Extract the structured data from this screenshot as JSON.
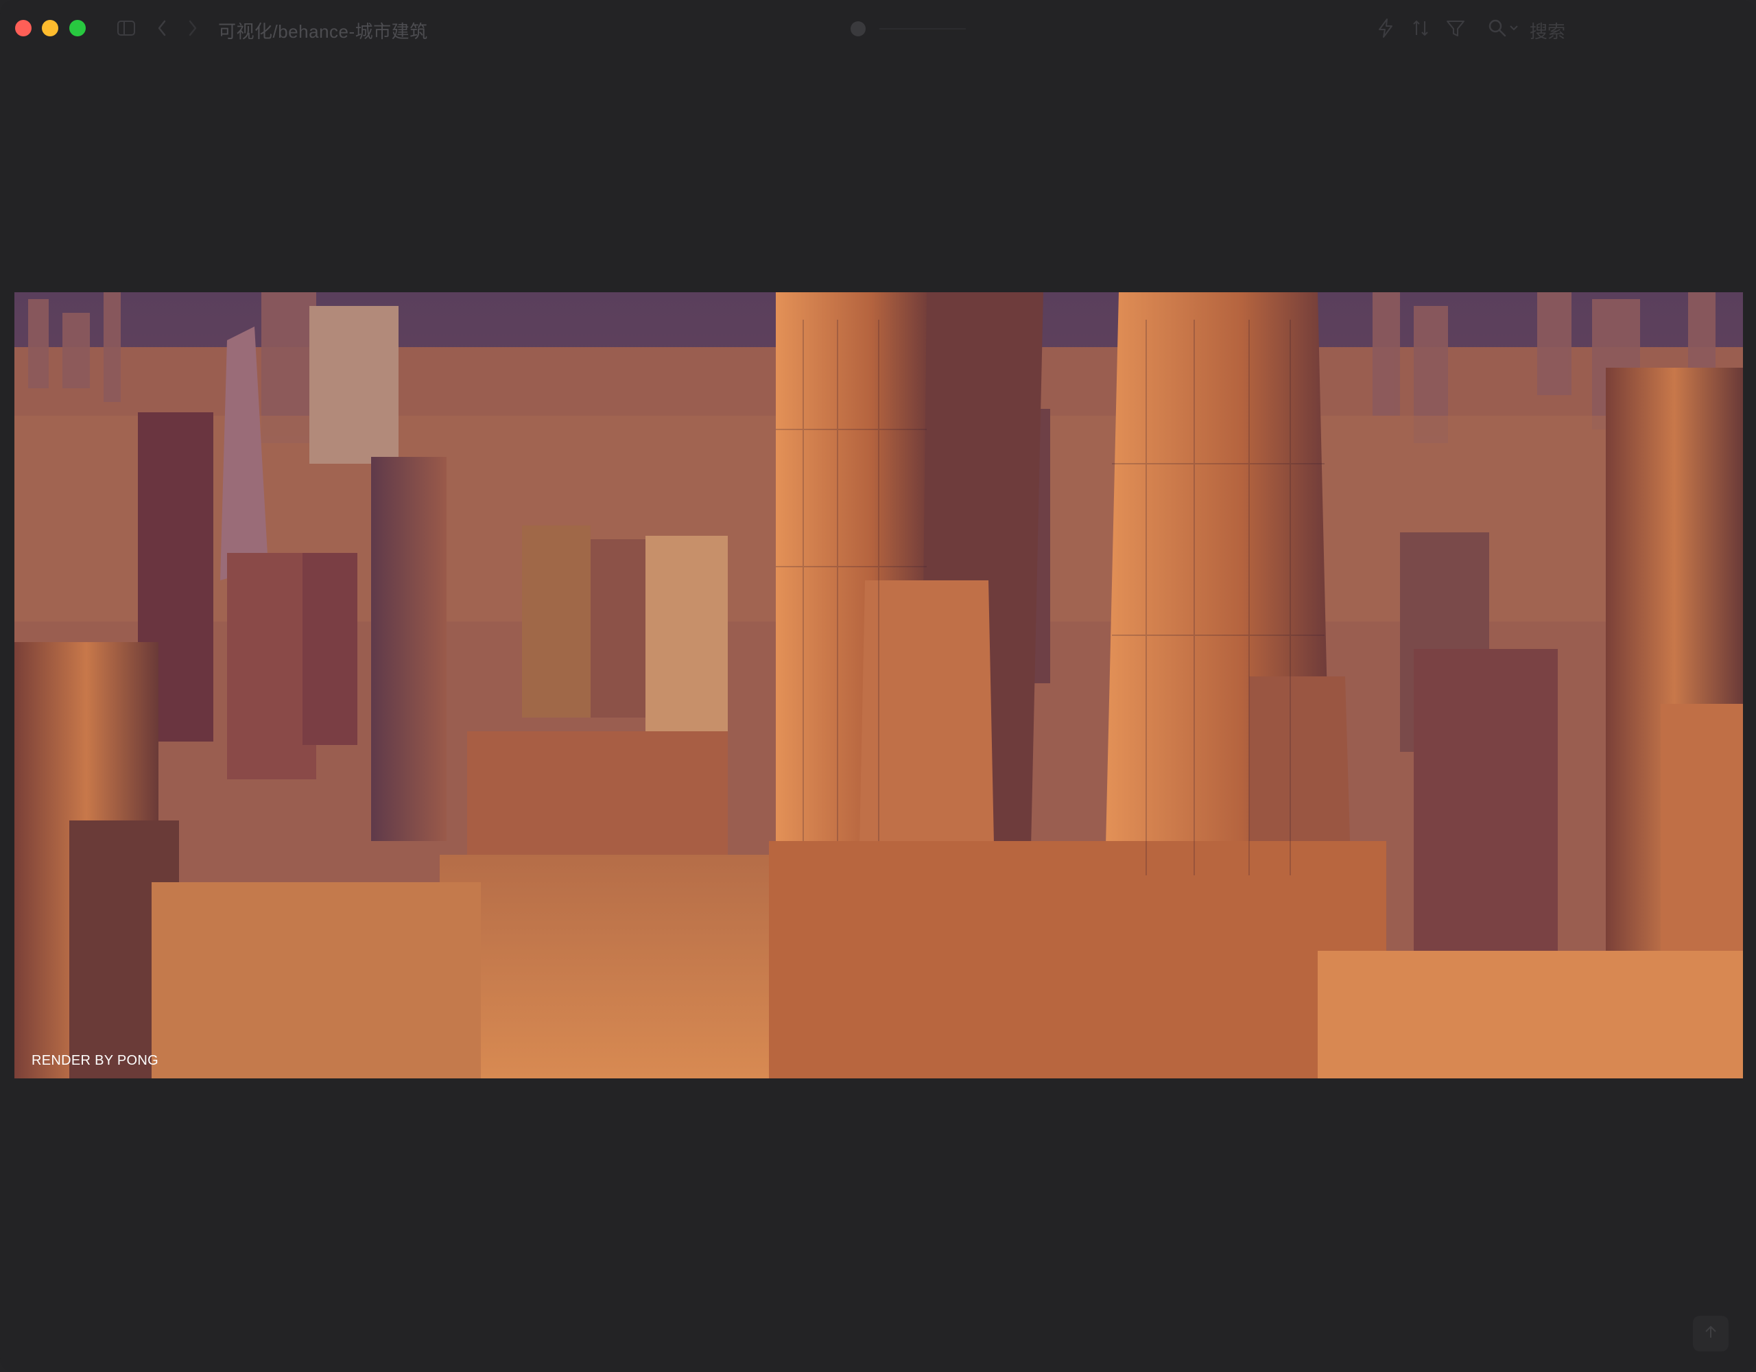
{
  "window": {
    "breadcrumb": "可视化/behance-城市建筑",
    "search_placeholder": "搜索"
  },
  "toolbar": {
    "icons": [
      "sidebar-icon",
      "back-icon",
      "forward-icon",
      "lightning-icon",
      "sort-icon",
      "filter-icon",
      "search-icon"
    ]
  },
  "image": {
    "subject": "aerial futuristic city skyline at sunset",
    "watermark": "RENDER BY PONG"
  },
  "colors": {
    "background": "#232325",
    "accent_close": "#fe5f57",
    "accent_min": "#febc2e",
    "accent_max": "#28c840"
  }
}
